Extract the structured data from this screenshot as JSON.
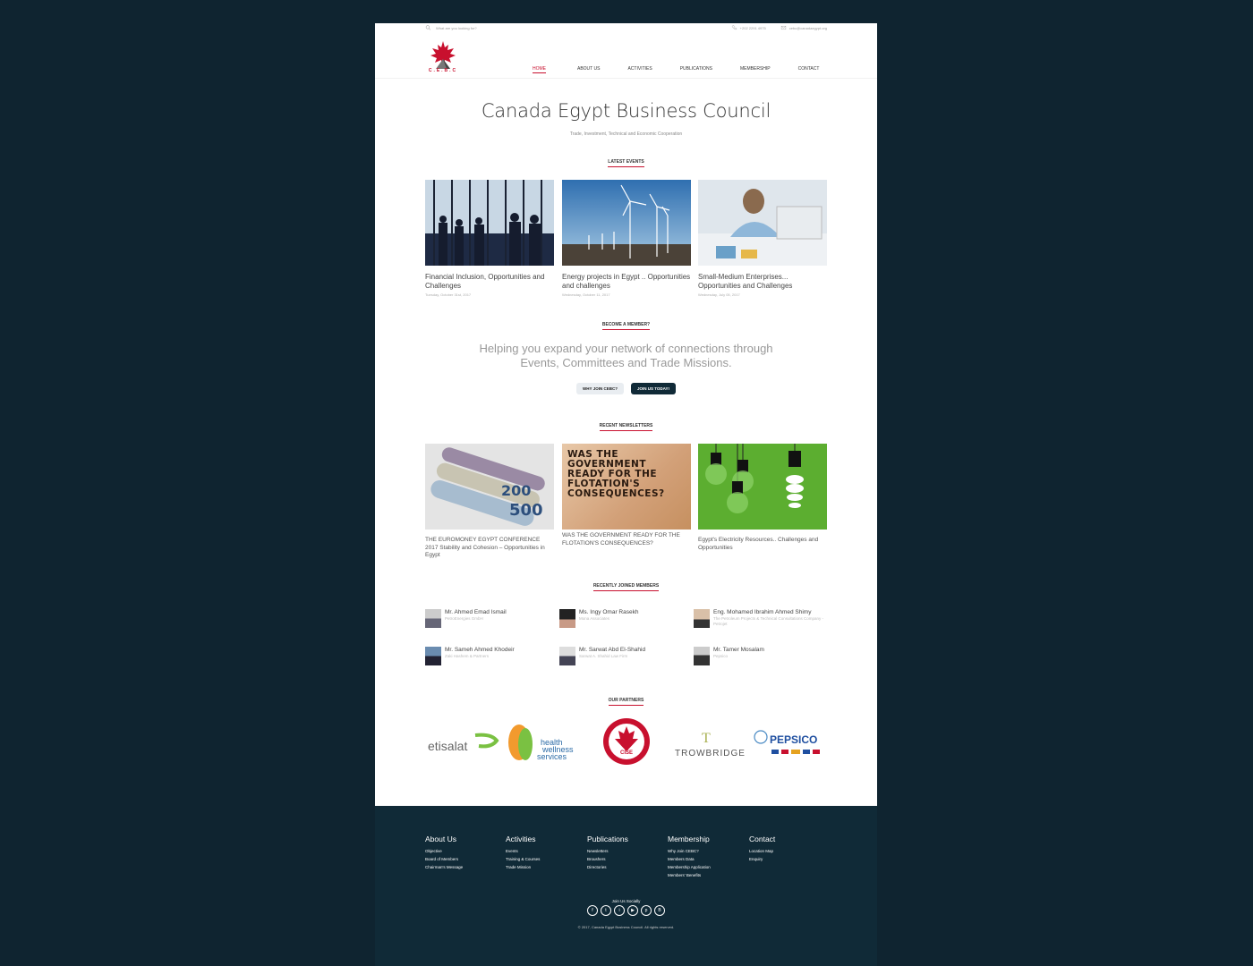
{
  "topbar": {
    "search_placeholder": "What are you looking for?",
    "phone": "+202 2291 4975",
    "email": "cebc@canadaegypt.org"
  },
  "logo": {
    "text": "C.E.B.C",
    "color": "#c8102e"
  },
  "nav": [
    "HOME",
    "ABOUT US",
    "ACTIVITIES",
    "PUBLICATIONS",
    "MEMBERSHIP",
    "CONTACT"
  ],
  "hero": {
    "title": "Canada Egypt Business Council",
    "subtitle": "Trade, Investment, Technical and Economic Cooperation"
  },
  "events": {
    "heading": "LATEST EVENTS",
    "items": [
      {
        "title": "Financial Inclusion, Opportunities and Challenges",
        "date": "Tuesday, October 31st, 2017"
      },
      {
        "title": "Energy projects in Egypt .. Opportunities and challenges",
        "date": "Wednesday, October 11, 2017"
      },
      {
        "title": "Small-Medium Enterprises... Opportunities and Challenges",
        "date": "Wednesday, July 05, 2017"
      }
    ]
  },
  "member_section": {
    "heading": "BECOME A MEMBER?",
    "text_line1": "Helping you expand your network of connections through",
    "text_line2": "Events, Committees and Trade Missions.",
    "btn_why": "WHY JOIN CEBC?",
    "btn_join": "JOIN US TODAY!"
  },
  "newsletters": {
    "heading": "RECENT NEWSLETTERS",
    "items": [
      {
        "title": "THE EUROMONEY EGYPT CONFERENCE 2017 Stability and Cohesion – Opportunities in Egypt"
      },
      {
        "title": "WAS THE GOVERNMENT READY FOR THE FLOTATION'S CONSEQUENCES?",
        "image_text": "WAS THE GOVERNMENT READY FOR THE FLOTATION'S CONSEQUENCES?"
      },
      {
        "title": "Egypt's Electricity Resources.. Challenges and Opportunities"
      }
    ],
    "banknote_values": [
      "200",
      "500"
    ]
  },
  "members": {
    "heading": "RECENTLY JOINED MEMBERS",
    "items": [
      {
        "name": "Mr. Ahmed Emad Ismail",
        "company": "PetroEnergies GmbH"
      },
      {
        "name": "Ms. Ingy Omar Rasekh",
        "company": "Mona Associates"
      },
      {
        "name": "Eng. Mohamed Ibrahim Ahmed Shimy",
        "company": "The Petroleum Projects & Technical Consultations Company - Petrojet"
      },
      {
        "name": "Mr. Sameh Ahmed Khodeir",
        "company": "Zaki Hashem & Partners"
      },
      {
        "name": "Mr. Sarwat Abd El-Shahid",
        "company": "Sarwat A. Shahid Law Firm"
      },
      {
        "name": "Mr. Tamer Mosalam",
        "company": "Pepsico"
      }
    ]
  },
  "partners": {
    "heading": "OUR PARTNERS",
    "etisalat": "etisalat",
    "hws_line1": "health",
    "hws_line2": "wellness",
    "hws_line3": "services",
    "cise_badge": "CISE",
    "cise_ring": "CANADIAN INTERNATIONAL SCHOOL OF EGYPT",
    "trowbridge": "TROWBRIDGE",
    "pepsico": "PEPSICO"
  },
  "footer": {
    "columns": [
      {
        "title": "About Us",
        "links": [
          "Objective",
          "Board of Members",
          "Chairman's Message"
        ]
      },
      {
        "title": "Activities",
        "links": [
          "Events",
          "Training & Courses",
          "Trade Mission"
        ]
      },
      {
        "title": "Publications",
        "links": [
          "Newsletters",
          "Broushers",
          "Directories"
        ]
      },
      {
        "title": "Membership",
        "links": [
          "Why Join CEBC?",
          "Members Data",
          "Membership Application",
          "Members' Benefits"
        ]
      },
      {
        "title": "Contact",
        "links": [
          "Location Map",
          "Enquiry"
        ]
      }
    ],
    "join_text": "Join Us Socially",
    "social": [
      "f",
      "t",
      "i",
      "▶",
      "p",
      "B"
    ],
    "copyright": "© 2017, Canada Egypt Business Council. All rights reserved."
  }
}
